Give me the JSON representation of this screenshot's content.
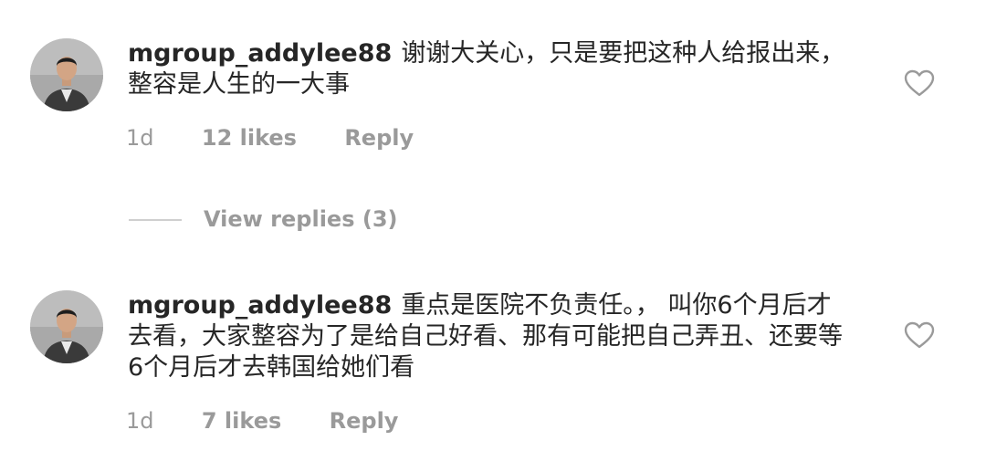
{
  "comments": [
    {
      "username": "mgroup_addylee88",
      "text": "谢谢大关心，只是要把这种人给报出来，整容是人生的一大事",
      "time": "1d",
      "likes": "12 likes",
      "reply_label": "Reply",
      "avatar_icon": "profile-photo",
      "like_icon": "heart-outline-icon"
    },
    {
      "username": "mgroup_addylee88",
      "text": "重点是医院不负责任。，  叫你6个月后才去看，大家整容为了是给自己好看、那有可能把自己弄丑、还要等6个月后才去韩国给她们看",
      "time": "1d",
      "likes": "7 likes",
      "reply_label": "Reply",
      "avatar_icon": "profile-photo",
      "like_icon": "heart-outline-icon"
    }
  ],
  "view_replies": "View replies (3)",
  "colors": {
    "text": "#262626",
    "meta": "#9a9a9a",
    "divider": "#cfcfcf"
  }
}
